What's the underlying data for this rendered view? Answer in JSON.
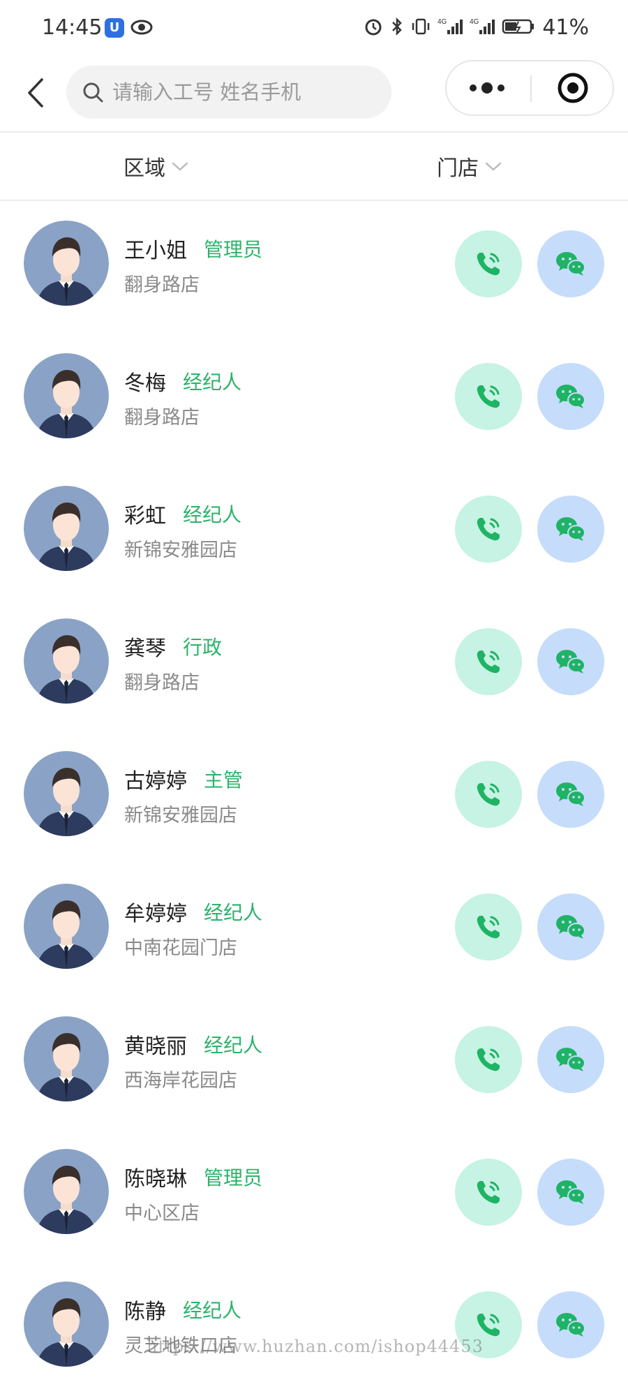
{
  "status_bar": {
    "time": "14:45",
    "battery": "41%",
    "icons": [
      "app-badge-icon",
      "eye-icon",
      "alarm-icon",
      "bluetooth-icon",
      "vibrate-icon",
      "signal-4g-icon",
      "signal-4g-icon",
      "battery-icon"
    ]
  },
  "nav": {
    "search_placeholder": "请输入工号 姓名手机"
  },
  "filters": {
    "region_label": "区域",
    "store_label": "门店"
  },
  "colors": {
    "role_green": "#2bb36a",
    "call_bg": "#c6f3e3",
    "chat_bg": "#c6dcfb",
    "avatar_bg": "#8aa2c6"
  },
  "staff": [
    {
      "name": "王小姐",
      "role": "管理员",
      "store": "翻身路店"
    },
    {
      "name": "冬梅",
      "role": "经纪人",
      "store": "翻身路店"
    },
    {
      "name": "彩虹",
      "role": "经纪人",
      "store": "新锦安雅园店"
    },
    {
      "name": "龚琴",
      "role": "行政",
      "store": "翻身路店"
    },
    {
      "name": "古婷婷",
      "role": "主管",
      "store": "新锦安雅园店"
    },
    {
      "name": "牟婷婷",
      "role": "经纪人",
      "store": "中南花园门店"
    },
    {
      "name": "黄晓丽",
      "role": "经纪人",
      "store": "西海岸花园店"
    },
    {
      "name": "陈晓琳",
      "role": "管理员",
      "store": "中心区店"
    },
    {
      "name": "陈静",
      "role": "经纪人",
      "store": "灵芝地铁口店"
    }
  ],
  "watermark": "https://www.huzhan.com/ishop44453"
}
